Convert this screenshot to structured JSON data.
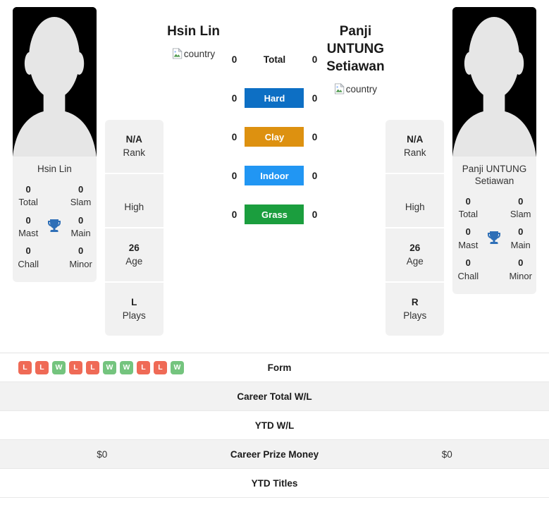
{
  "players": {
    "left": {
      "heading": "Hsin Lin",
      "card_name": "Hsin Lin",
      "flag_alt": "country",
      "avatar_name": "player-avatar-placeholder",
      "titles": [
        {
          "value": "0",
          "label": "Total"
        },
        {
          "value": "0",
          "label": "Slam"
        },
        {
          "value": "0",
          "label": "Mast"
        },
        {
          "value": "0",
          "label": "Main"
        },
        {
          "value": "0",
          "label": "Chall"
        },
        {
          "value": "0",
          "label": "Minor"
        }
      ],
      "info": [
        {
          "value": "N/A",
          "label": "Rank"
        },
        {
          "value": "",
          "label": "High"
        },
        {
          "value": "26",
          "label": "Age"
        },
        {
          "value": "L",
          "label": "Plays"
        }
      ],
      "form": [
        "L",
        "L",
        "W",
        "L",
        "L",
        "W",
        "W",
        "L",
        "L",
        "W"
      ],
      "career_total_wl": "",
      "ytd_wl": "",
      "career_prize_money": "$0",
      "ytd_titles": ""
    },
    "right": {
      "heading": "Panji UNTUNG Setiawan",
      "card_name": "Panji UNTUNG Setiawan",
      "flag_alt": "country",
      "avatar_name": "player-avatar-placeholder",
      "titles": [
        {
          "value": "0",
          "label": "Total"
        },
        {
          "value": "0",
          "label": "Slam"
        },
        {
          "value": "0",
          "label": "Mast"
        },
        {
          "value": "0",
          "label": "Main"
        },
        {
          "value": "0",
          "label": "Chall"
        },
        {
          "value": "0",
          "label": "Minor"
        }
      ],
      "info": [
        {
          "value": "N/A",
          "label": "Rank"
        },
        {
          "value": "",
          "label": "High"
        },
        {
          "value": "26",
          "label": "Age"
        },
        {
          "value": "R",
          "label": "Plays"
        }
      ],
      "form": [],
      "career_total_wl": "",
      "ytd_wl": "",
      "career_prize_money": "$0",
      "ytd_titles": ""
    }
  },
  "surfaces": [
    {
      "label": "Total",
      "left": "0",
      "right": "0",
      "color": "transparent",
      "plain": true
    },
    {
      "label": "Hard",
      "left": "0",
      "right": "0",
      "color": "#0d6fc4",
      "plain": false
    },
    {
      "label": "Clay",
      "left": "0",
      "right": "0",
      "color": "#dd9110",
      "plain": false
    },
    {
      "label": "Indoor",
      "left": "0",
      "right": "0",
      "color": "#2196f3",
      "plain": false
    },
    {
      "label": "Grass",
      "left": "0",
      "right": "0",
      "color": "#1b9e3e",
      "plain": false
    }
  ],
  "stat_rows": [
    {
      "label": "Form",
      "shaded": false
    },
    {
      "label": "Career Total W/L",
      "shaded": true
    },
    {
      "label": "YTD W/L",
      "shaded": false
    },
    {
      "label": "Career Prize Money",
      "shaded": true
    },
    {
      "label": "YTD Titles",
      "shaded": false
    }
  ],
  "colors": {
    "win": "#74c47e",
    "loss": "#ef6a56",
    "panel": "#f1f1f1",
    "row_shade": "#f2f2f2",
    "trophy": "#2e6fb7"
  }
}
